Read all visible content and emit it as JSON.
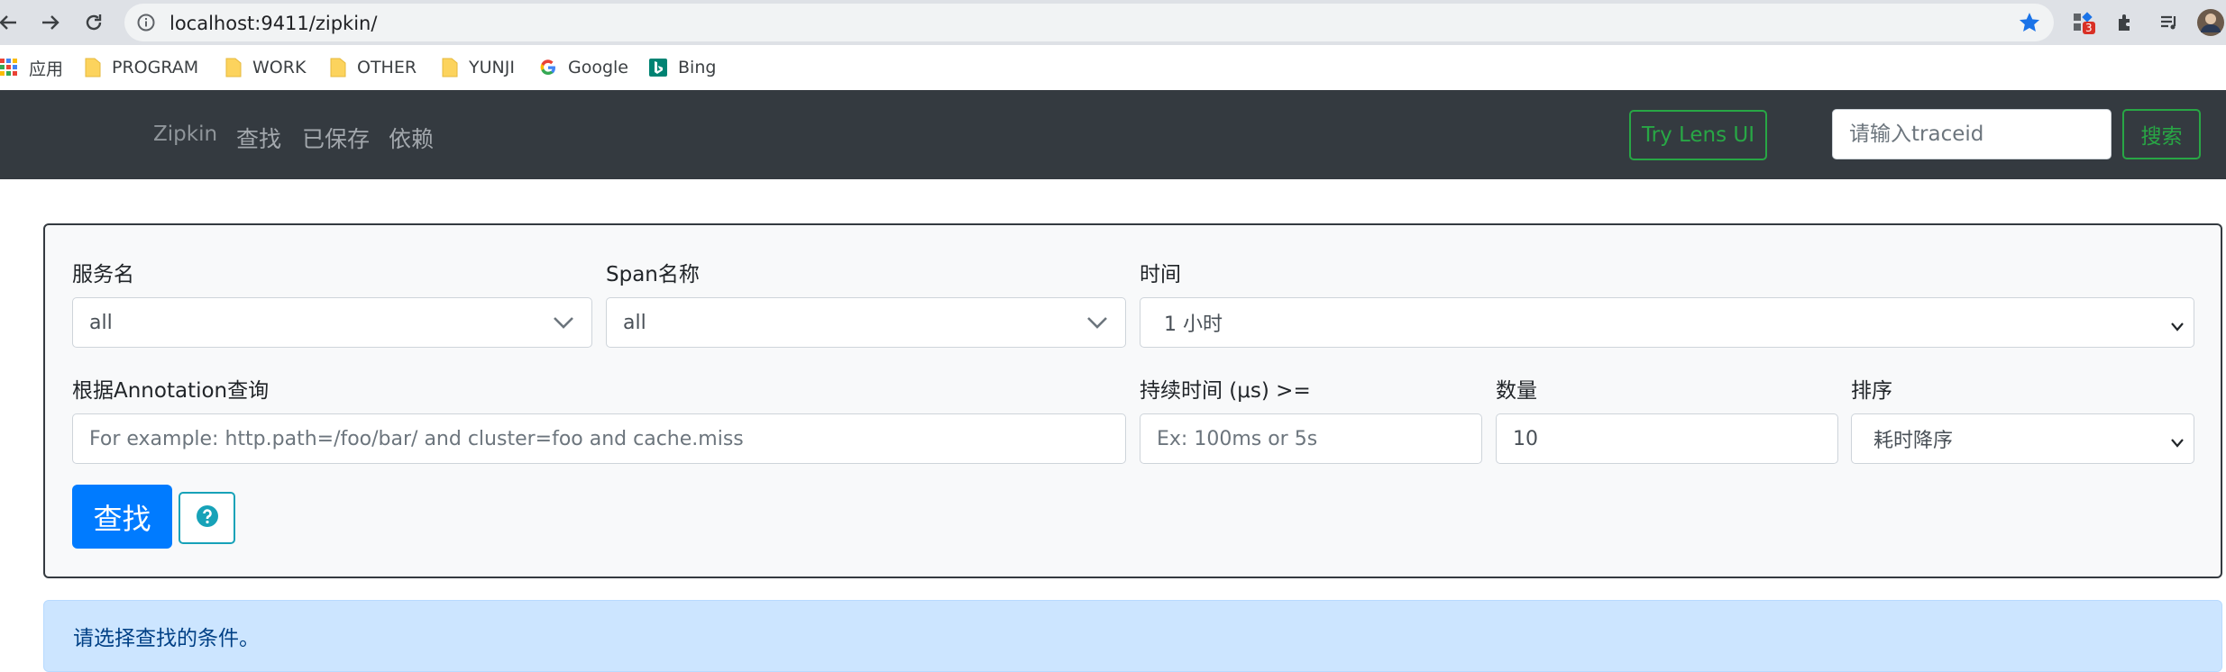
{
  "browser": {
    "url": "localhost:9411/zipkin/",
    "extension_badge": "3",
    "bookmarks": [
      {
        "label": "应用",
        "icon": "apps-grid-icon"
      },
      {
        "label": "PROGRAM",
        "icon": "folder-icon"
      },
      {
        "label": "WORK",
        "icon": "folder-icon"
      },
      {
        "label": "OTHER",
        "icon": "folder-icon"
      },
      {
        "label": "YUNJI",
        "icon": "folder-icon"
      },
      {
        "label": "Google",
        "icon": "google-icon"
      },
      {
        "label": "Bing",
        "icon": "bing-icon"
      }
    ]
  },
  "navbar": {
    "brand": "Zipkin",
    "links": [
      "查找",
      "已保存",
      "依赖"
    ],
    "lens_button": "Try Lens UI",
    "trace_placeholder": "请输入traceid",
    "search_button": "搜索"
  },
  "form": {
    "service_label": "服务名",
    "service_value": "all",
    "span_label": "Span名称",
    "span_value": "all",
    "time_label": "时间",
    "time_value": "1 小时",
    "annotation_label": "根据Annotation查询",
    "annotation_placeholder": "For example: http.path=/foo/bar/ and cluster=foo and cache.miss",
    "duration_label": "持续时间 (μs) >=",
    "duration_placeholder": "Ex: 100ms or 5s",
    "limit_label": "数量",
    "limit_value": "10",
    "sort_label": "排序",
    "sort_value": "耗时降序",
    "find_button": "查找"
  },
  "alert": {
    "message": "请选择查找的条件。"
  },
  "colors": {
    "navbar_bg": "#343a40",
    "accent_green": "#28a745",
    "primary_blue": "#007bff",
    "info_teal": "#17a2b8",
    "alert_bg": "#cce5ff"
  }
}
